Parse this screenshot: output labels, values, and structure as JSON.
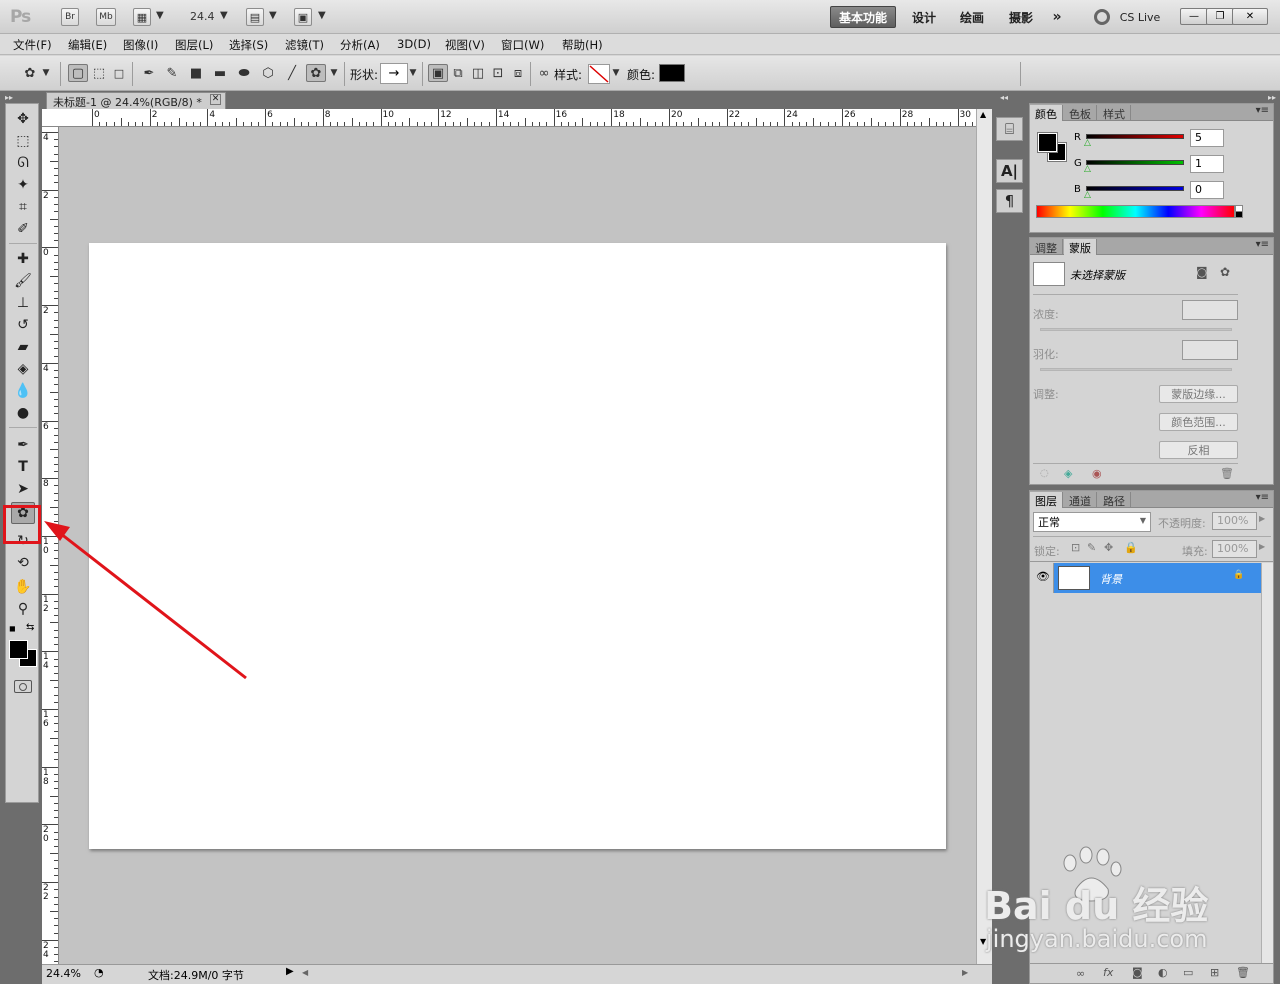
{
  "titlebar": {
    "app_logo": "Ps",
    "bridge_label": "Br",
    "minibridge_label": "Mb",
    "zoom_value": "24.4",
    "workspaces": [
      "基本功能",
      "设计",
      "绘画",
      "摄影"
    ],
    "active_workspace": "基本功能",
    "more_symbol": "»",
    "cs_live_label": "CS Live",
    "win_min": "—",
    "win_restore": "❐",
    "win_close": "✕"
  },
  "menu": [
    "文件(F)",
    "编辑(E)",
    "图像(I)",
    "图层(L)",
    "选择(S)",
    "滤镜(T)",
    "分析(A)",
    "3D(D)",
    "视图(V)",
    "窗口(W)",
    "帮助(H)"
  ],
  "options": {
    "shape_label": "形状:",
    "style_label": "样式:",
    "color_label": "颜色:",
    "color_value": "#000000"
  },
  "document": {
    "tab_title": "未标题-1 @ 24.4%(RGB/8) *",
    "ruler_top": [
      "0",
      "2",
      "4",
      "6",
      "8",
      "10",
      "12",
      "14",
      "16",
      "18",
      "20",
      "22",
      "24",
      "26",
      "28",
      "30"
    ],
    "ruler_left": [
      "4",
      "2",
      "0",
      "2",
      "4",
      "6",
      "8",
      "10",
      "12",
      "14",
      "16",
      "18",
      "20",
      "22",
      "24"
    ],
    "zoom_status": "24.4%",
    "doc_status": "文档:24.9M/0 字节"
  },
  "color_panel": {
    "tabs": [
      "颜色",
      "色板",
      "样式"
    ],
    "channels": [
      {
        "label": "R",
        "value": "5",
        "color": "#e00000"
      },
      {
        "label": "G",
        "value": "1",
        "color": "#00c000"
      },
      {
        "label": "B",
        "value": "0",
        "color": "#0000e0"
      }
    ]
  },
  "masks_panel": {
    "tabs": [
      "调整",
      "蒙版"
    ],
    "mask_status": "未选择蒙版",
    "density_label": "浓度:",
    "feather_label": "羽化:",
    "refine_label": "调整:",
    "mask_edge_button": "蒙版边缘...",
    "color_range_button": "颜色范围...",
    "invert_button": "反相"
  },
  "layers_panel": {
    "tabs": [
      "图层",
      "通道",
      "路径"
    ],
    "blend_mode": "正常",
    "opacity_label": "不透明度:",
    "opacity_value": "100%",
    "lock_label": "锁定:",
    "fill_label": "填充:",
    "fill_value": "100%",
    "layers": [
      {
        "name": "背景"
      }
    ],
    "footer_fx": "fx"
  },
  "watermark": {
    "brand": "Bai du 经验",
    "url": "jingyan.baidu.com"
  },
  "annotation_color": "#e0141a"
}
